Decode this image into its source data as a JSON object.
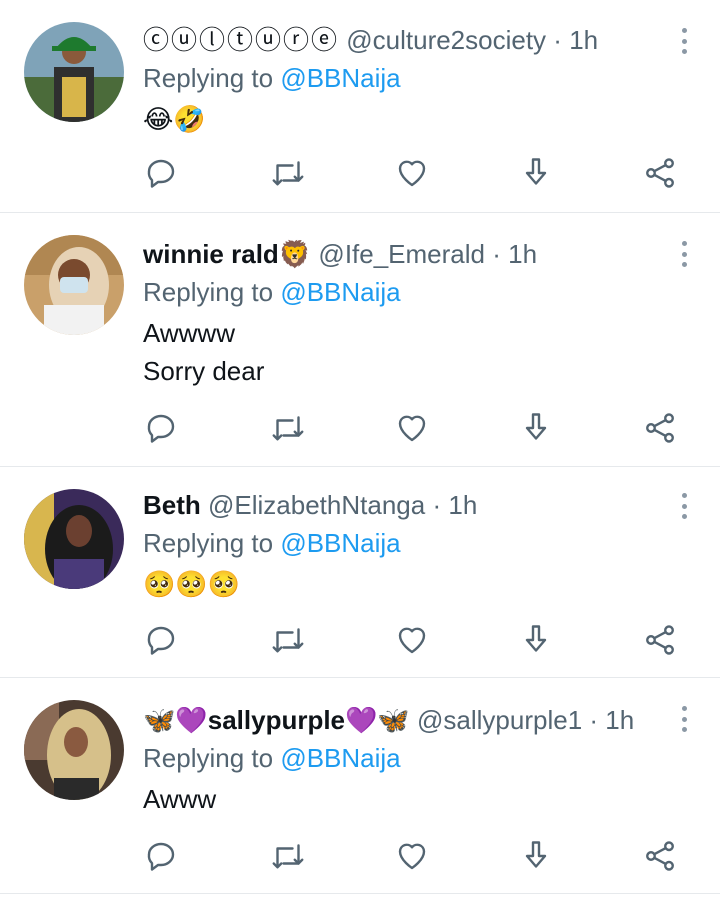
{
  "tweets": [
    {
      "display_name": "ⓒⓤⓛⓣⓤⓡⓔ",
      "handle": "@culture2society",
      "separator": "·",
      "time": "1h",
      "replying_prefix": "Replying to",
      "replying_to": "@BBNaija",
      "body": [
        "😂🤣"
      ]
    },
    {
      "display_name": "winnie rald🦁",
      "handle": "@Ife_Emerald",
      "separator": "·",
      "time": "1h",
      "replying_prefix": "Replying to",
      "replying_to": "@BBNaija",
      "body": [
        "Awwww",
        "Sorry dear"
      ]
    },
    {
      "display_name": "Beth",
      "handle": "@ElizabethNtanga",
      "separator": "·",
      "time": "1h",
      "replying_prefix": "Replying to",
      "replying_to": "@BBNaija",
      "body": [
        "🥺🥺🥺"
      ]
    },
    {
      "display_name": "🦋💜sallypurple💜🦋",
      "handle": "@sallypurple1",
      "separator": "·",
      "time": "1h",
      "replying_prefix": "Replying to",
      "replying_to": "@BBNaija",
      "body": [
        "Awww"
      ]
    }
  ],
  "icons": {
    "reply": "reply-icon",
    "retweet": "retweet-icon",
    "like": "heart-icon",
    "save": "download-icon",
    "share": "share-icon",
    "more": "more-options-icon"
  },
  "colors": {
    "mention": "#1d9bf0",
    "secondary_text": "#536471",
    "icon": "#536471",
    "divider": "#e6e9ec"
  }
}
